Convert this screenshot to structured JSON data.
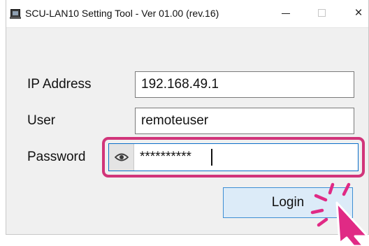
{
  "window": {
    "title": "SCU-LAN10 Setting Tool - Ver 01.00 (rev.16)",
    "close_glyph": "×"
  },
  "form": {
    "ip_label": "IP Address",
    "ip_value": "192.168.49.1",
    "user_label": "User",
    "user_value": "remoteuser",
    "password_label": "Password",
    "password_value": "**********",
    "login_label": "Login"
  },
  "colors": {
    "highlight": "#d1357a",
    "focus_border": "#0a6fc9",
    "button_fill": "#dcebf8",
    "button_border": "#3d8ed4"
  },
  "icons": {
    "app": "app-icon",
    "show_password": "eye-icon",
    "pointer": "hand-pointer-icon",
    "click": "click-burst-icon"
  }
}
